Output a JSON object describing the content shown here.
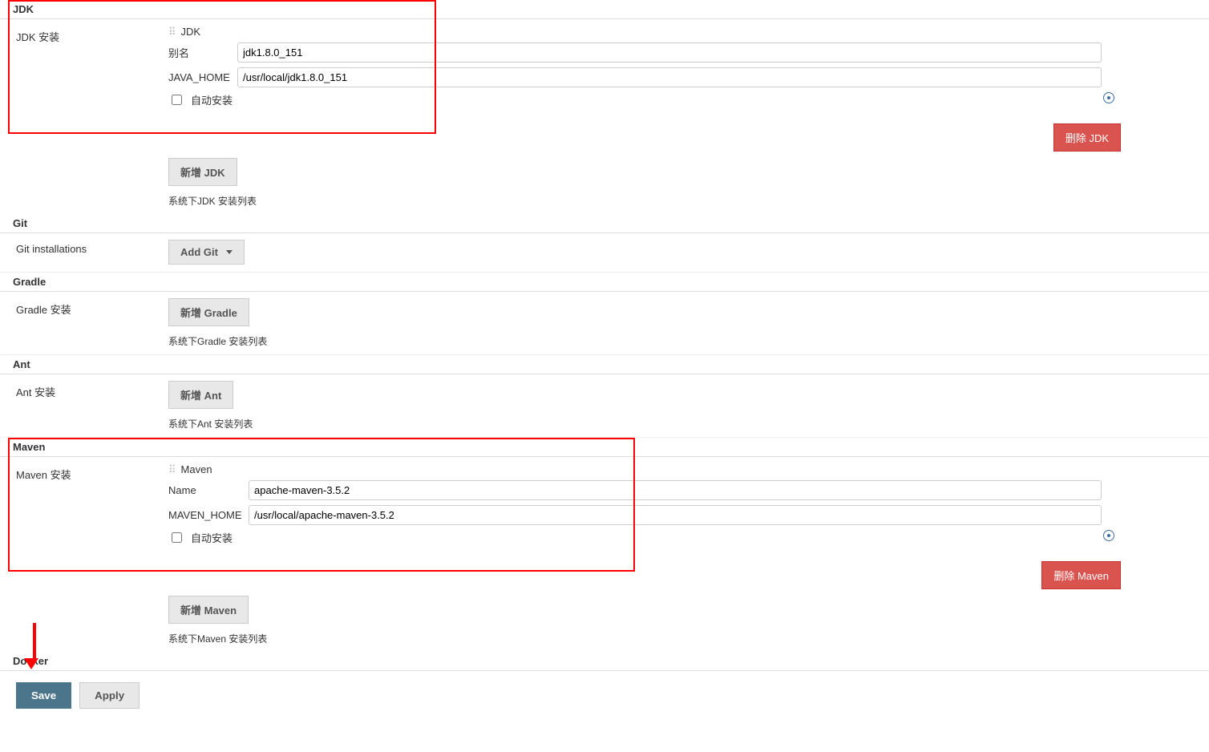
{
  "jdk": {
    "title": "JDK",
    "install_label": "JDK 安装",
    "item_title": "JDK",
    "alias_label": "别名",
    "alias_value": "jdk1.8.0_151",
    "home_label": "JAVA_HOME",
    "home_value": "/usr/local/jdk1.8.0_151",
    "auto_label": "自动安装",
    "delete_label": "删除 JDK",
    "add_label": "新增 JDK",
    "list_text": "系统下JDK 安装列表"
  },
  "git": {
    "title": "Git",
    "install_label": "Git installations",
    "add_label": "Add Git"
  },
  "gradle": {
    "title": "Gradle",
    "install_label": "Gradle 安装",
    "add_label": "新增 Gradle",
    "list_text": "系统下Gradle 安装列表"
  },
  "ant": {
    "title": "Ant",
    "install_label": "Ant 安装",
    "add_label": "新增 Ant",
    "list_text": "系统下Ant 安装列表"
  },
  "maven": {
    "title": "Maven",
    "install_label": "Maven 安装",
    "item_title": "Maven",
    "name_label": "Name",
    "name_value": "apache-maven-3.5.2",
    "home_label": "MAVEN_HOME",
    "home_value": "/usr/local/apache-maven-3.5.2",
    "auto_label": "自动安装",
    "delete_label": "删除 Maven",
    "add_label": "新增 Maven",
    "list_text": "系统下Maven 安装列表"
  },
  "docker": {
    "title": "Docker"
  },
  "actions": {
    "save": "Save",
    "apply": "Apply"
  }
}
